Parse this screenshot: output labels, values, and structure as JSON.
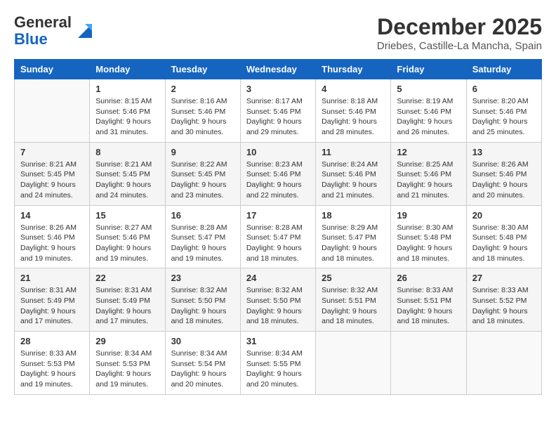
{
  "logo": {
    "line1": "General",
    "line2": "Blue"
  },
  "title": "December 2025",
  "location": "Driebes, Castille-La Mancha, Spain",
  "days_of_week": [
    "Sunday",
    "Monday",
    "Tuesday",
    "Wednesday",
    "Thursday",
    "Friday",
    "Saturday"
  ],
  "weeks": [
    [
      {
        "day": "",
        "info": ""
      },
      {
        "day": "1",
        "info": "Sunrise: 8:15 AM\nSunset: 5:46 PM\nDaylight: 9 hours\nand 31 minutes."
      },
      {
        "day": "2",
        "info": "Sunrise: 8:16 AM\nSunset: 5:46 PM\nDaylight: 9 hours\nand 30 minutes."
      },
      {
        "day": "3",
        "info": "Sunrise: 8:17 AM\nSunset: 5:46 PM\nDaylight: 9 hours\nand 29 minutes."
      },
      {
        "day": "4",
        "info": "Sunrise: 8:18 AM\nSunset: 5:46 PM\nDaylight: 9 hours\nand 28 minutes."
      },
      {
        "day": "5",
        "info": "Sunrise: 8:19 AM\nSunset: 5:46 PM\nDaylight: 9 hours\nand 26 minutes."
      },
      {
        "day": "6",
        "info": "Sunrise: 8:20 AM\nSunset: 5:46 PM\nDaylight: 9 hours\nand 25 minutes."
      }
    ],
    [
      {
        "day": "7",
        "info": "Sunrise: 8:21 AM\nSunset: 5:45 PM\nDaylight: 9 hours\nand 24 minutes."
      },
      {
        "day": "8",
        "info": "Sunrise: 8:21 AM\nSunset: 5:45 PM\nDaylight: 9 hours\nand 24 minutes."
      },
      {
        "day": "9",
        "info": "Sunrise: 8:22 AM\nSunset: 5:45 PM\nDaylight: 9 hours\nand 23 minutes."
      },
      {
        "day": "10",
        "info": "Sunrise: 8:23 AM\nSunset: 5:46 PM\nDaylight: 9 hours\nand 22 minutes."
      },
      {
        "day": "11",
        "info": "Sunrise: 8:24 AM\nSunset: 5:46 PM\nDaylight: 9 hours\nand 21 minutes."
      },
      {
        "day": "12",
        "info": "Sunrise: 8:25 AM\nSunset: 5:46 PM\nDaylight: 9 hours\nand 21 minutes."
      },
      {
        "day": "13",
        "info": "Sunrise: 8:26 AM\nSunset: 5:46 PM\nDaylight: 9 hours\nand 20 minutes."
      }
    ],
    [
      {
        "day": "14",
        "info": "Sunrise: 8:26 AM\nSunset: 5:46 PM\nDaylight: 9 hours\nand 19 minutes."
      },
      {
        "day": "15",
        "info": "Sunrise: 8:27 AM\nSunset: 5:46 PM\nDaylight: 9 hours\nand 19 minutes."
      },
      {
        "day": "16",
        "info": "Sunrise: 8:28 AM\nSunset: 5:47 PM\nDaylight: 9 hours\nand 19 minutes."
      },
      {
        "day": "17",
        "info": "Sunrise: 8:28 AM\nSunset: 5:47 PM\nDaylight: 9 hours\nand 18 minutes."
      },
      {
        "day": "18",
        "info": "Sunrise: 8:29 AM\nSunset: 5:47 PM\nDaylight: 9 hours\nand 18 minutes."
      },
      {
        "day": "19",
        "info": "Sunrise: 8:30 AM\nSunset: 5:48 PM\nDaylight: 9 hours\nand 18 minutes."
      },
      {
        "day": "20",
        "info": "Sunrise: 8:30 AM\nSunset: 5:48 PM\nDaylight: 9 hours\nand 18 minutes."
      }
    ],
    [
      {
        "day": "21",
        "info": "Sunrise: 8:31 AM\nSunset: 5:49 PM\nDaylight: 9 hours\nand 17 minutes."
      },
      {
        "day": "22",
        "info": "Sunrise: 8:31 AM\nSunset: 5:49 PM\nDaylight: 9 hours\nand 17 minutes."
      },
      {
        "day": "23",
        "info": "Sunrise: 8:32 AM\nSunset: 5:50 PM\nDaylight: 9 hours\nand 18 minutes."
      },
      {
        "day": "24",
        "info": "Sunrise: 8:32 AM\nSunset: 5:50 PM\nDaylight: 9 hours\nand 18 minutes."
      },
      {
        "day": "25",
        "info": "Sunrise: 8:32 AM\nSunset: 5:51 PM\nDaylight: 9 hours\nand 18 minutes."
      },
      {
        "day": "26",
        "info": "Sunrise: 8:33 AM\nSunset: 5:51 PM\nDaylight: 9 hours\nand 18 minutes."
      },
      {
        "day": "27",
        "info": "Sunrise: 8:33 AM\nSunset: 5:52 PM\nDaylight: 9 hours\nand 18 minutes."
      }
    ],
    [
      {
        "day": "28",
        "info": "Sunrise: 8:33 AM\nSunset: 5:53 PM\nDaylight: 9 hours\nand 19 minutes."
      },
      {
        "day": "29",
        "info": "Sunrise: 8:34 AM\nSunset: 5:53 PM\nDaylight: 9 hours\nand 19 minutes."
      },
      {
        "day": "30",
        "info": "Sunrise: 8:34 AM\nSunset: 5:54 PM\nDaylight: 9 hours\nand 20 minutes."
      },
      {
        "day": "31",
        "info": "Sunrise: 8:34 AM\nSunset: 5:55 PM\nDaylight: 9 hours\nand 20 minutes."
      },
      {
        "day": "",
        "info": ""
      },
      {
        "day": "",
        "info": ""
      },
      {
        "day": "",
        "info": ""
      }
    ]
  ]
}
